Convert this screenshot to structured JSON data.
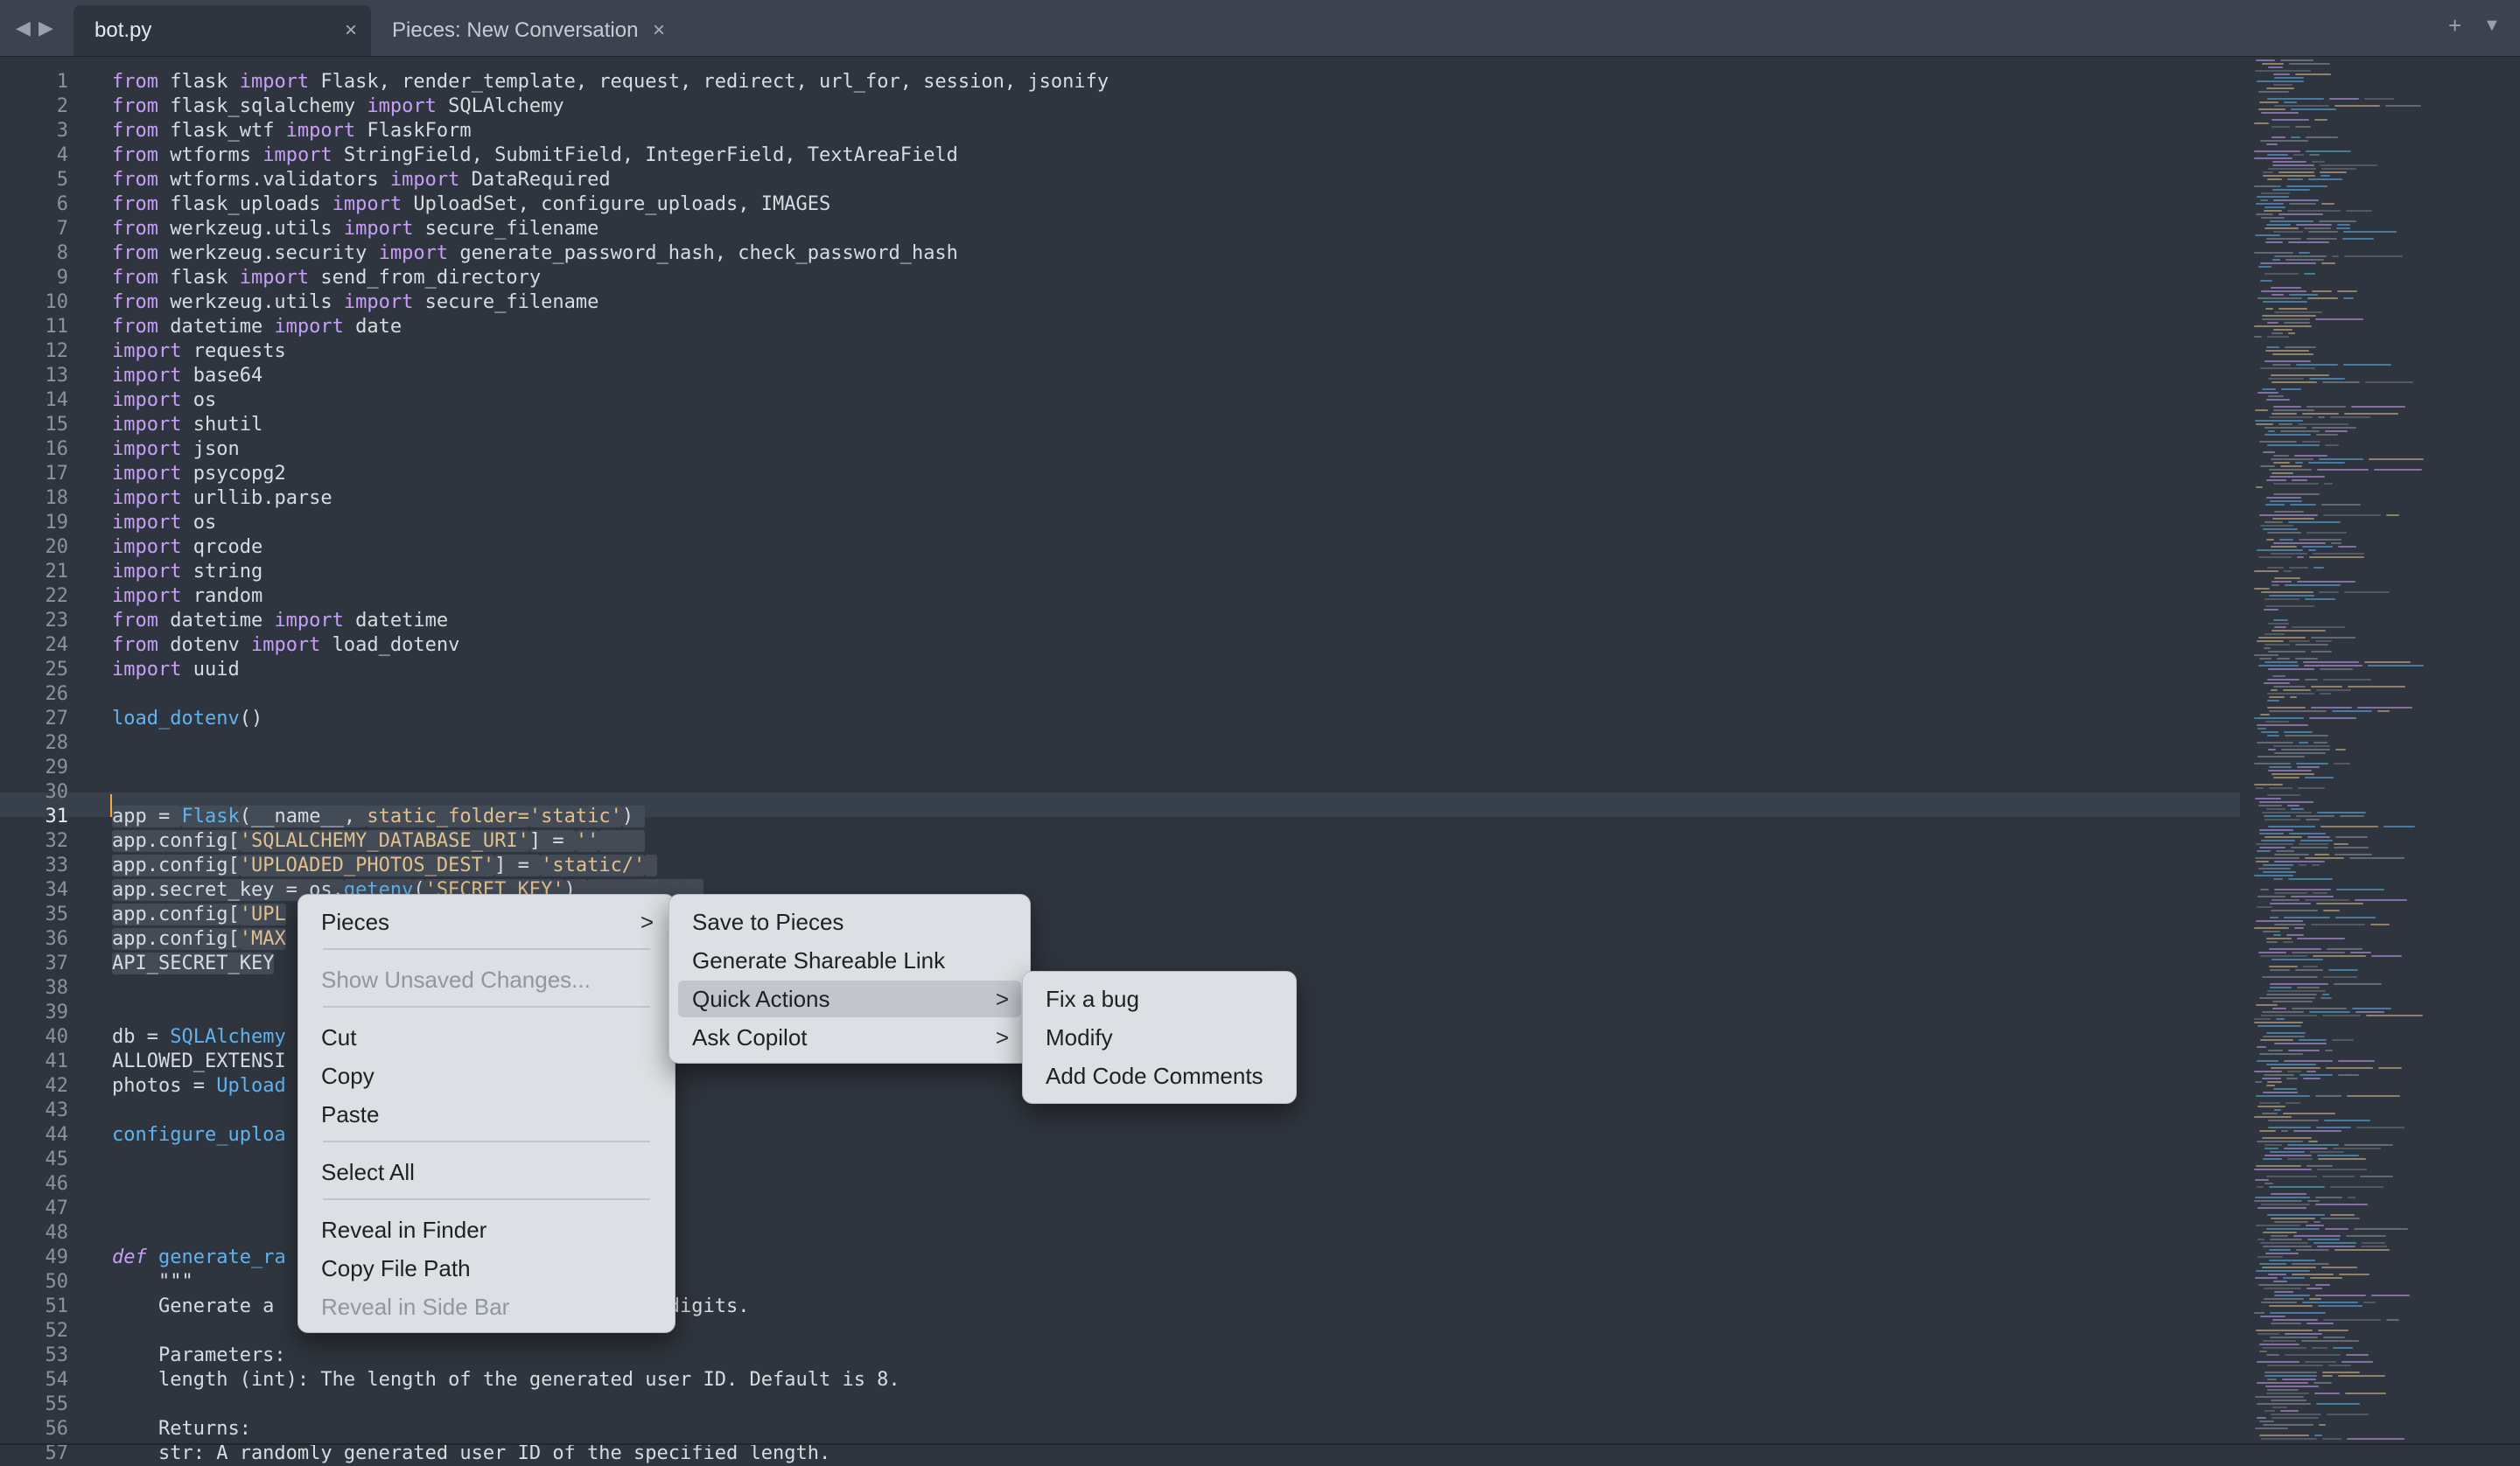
{
  "tabs": {
    "nav_back": "◀",
    "nav_forward": "▶",
    "items": [
      {
        "label": "bot.py",
        "close": "×"
      },
      {
        "label": "Pieces: New Conversation",
        "close": "×"
      }
    ],
    "new_tab": "+",
    "dropdown": "▼"
  },
  "editor": {
    "current_line": 31,
    "line_numbers": [
      "1",
      "2",
      "3",
      "4",
      "5",
      "6",
      "7",
      "8",
      "9",
      "10",
      "11",
      "12",
      "13",
      "14",
      "15",
      "16",
      "17",
      "18",
      "19",
      "20",
      "21",
      "22",
      "23",
      "24",
      "25",
      "26",
      "27",
      "28",
      "29",
      "30",
      "31",
      "32",
      "33",
      "34",
      "35",
      "36",
      "37",
      "38",
      "39",
      "40",
      "41",
      "42",
      "43",
      "44",
      "45",
      "46",
      "47",
      "48",
      "49",
      "50",
      "51",
      "52",
      "53",
      "54",
      "55",
      "56",
      "57"
    ],
    "lines": [
      [
        {
          "t": "from",
          "c": "kw"
        },
        {
          "t": " flask "
        },
        {
          "t": "import",
          "c": "kw"
        },
        {
          "t": " Flask, render_template, request, redirect, url_for, session, jsonify"
        }
      ],
      [
        {
          "t": "from",
          "c": "kw"
        },
        {
          "t": " flask_sqlalchemy "
        },
        {
          "t": "import",
          "c": "kw"
        },
        {
          "t": " SQLAlchemy"
        }
      ],
      [
        {
          "t": "from",
          "c": "kw"
        },
        {
          "t": " flask_wtf "
        },
        {
          "t": "import",
          "c": "kw"
        },
        {
          "t": " FlaskForm"
        }
      ],
      [
        {
          "t": "from",
          "c": "kw"
        },
        {
          "t": " wtforms "
        },
        {
          "t": "import",
          "c": "kw"
        },
        {
          "t": " StringField, SubmitField, IntegerField, TextAreaField"
        }
      ],
      [
        {
          "t": "from",
          "c": "kw"
        },
        {
          "t": " wtforms.validators "
        },
        {
          "t": "import",
          "c": "kw"
        },
        {
          "t": " DataRequired"
        }
      ],
      [
        {
          "t": "from",
          "c": "kw"
        },
        {
          "t": " flask_uploads "
        },
        {
          "t": "import",
          "c": "kw"
        },
        {
          "t": " UploadSet, configure_uploads, IMAGES"
        }
      ],
      [
        {
          "t": "from",
          "c": "kw"
        },
        {
          "t": " werkzeug.utils "
        },
        {
          "t": "import",
          "c": "kw"
        },
        {
          "t": " secure_filename"
        }
      ],
      [
        {
          "t": "from",
          "c": "kw"
        },
        {
          "t": " werkzeug.security "
        },
        {
          "t": "import",
          "c": "kw"
        },
        {
          "t": " generate_password_hash, check_password_hash"
        }
      ],
      [
        {
          "t": "from",
          "c": "kw"
        },
        {
          "t": " flask "
        },
        {
          "t": "import",
          "c": "kw"
        },
        {
          "t": " send_from_directory"
        }
      ],
      [
        {
          "t": "from",
          "c": "kw"
        },
        {
          "t": " werkzeug.utils "
        },
        {
          "t": "import",
          "c": "kw"
        },
        {
          "t": " secure_filename"
        }
      ],
      [
        {
          "t": "from",
          "c": "kw"
        },
        {
          "t": " datetime "
        },
        {
          "t": "import",
          "c": "kw"
        },
        {
          "t": " date"
        }
      ],
      [
        {
          "t": "import",
          "c": "kw"
        },
        {
          "t": " requests"
        }
      ],
      [
        {
          "t": "import",
          "c": "kw"
        },
        {
          "t": " base64"
        }
      ],
      [
        {
          "t": "import",
          "c": "kw"
        },
        {
          "t": " os"
        }
      ],
      [
        {
          "t": "import",
          "c": "kw"
        },
        {
          "t": " shutil"
        }
      ],
      [
        {
          "t": "import",
          "c": "kw"
        },
        {
          "t": " json"
        }
      ],
      [
        {
          "t": "import",
          "c": "kw"
        },
        {
          "t": " psycopg2"
        }
      ],
      [
        {
          "t": "import",
          "c": "kw"
        },
        {
          "t": " urllib.parse"
        }
      ],
      [
        {
          "t": "import",
          "c": "kw"
        },
        {
          "t": " os"
        }
      ],
      [
        {
          "t": "import",
          "c": "kw"
        },
        {
          "t": " qrcode"
        }
      ],
      [
        {
          "t": "import",
          "c": "kw"
        },
        {
          "t": " string"
        }
      ],
      [
        {
          "t": "import",
          "c": "kw"
        },
        {
          "t": " random"
        }
      ],
      [
        {
          "t": "from",
          "c": "kw"
        },
        {
          "t": " datetime "
        },
        {
          "t": "import",
          "c": "kw"
        },
        {
          "t": " datetime"
        }
      ],
      [
        {
          "t": "from",
          "c": "kw"
        },
        {
          "t": " dotenv "
        },
        {
          "t": "import",
          "c": "kw"
        },
        {
          "t": " load_dotenv"
        }
      ],
      [
        {
          "t": "import",
          "c": "kw"
        },
        {
          "t": " uuid"
        }
      ],
      [],
      [
        {
          "t": "load_dotenv",
          "c": "fn"
        },
        {
          "t": "()"
        }
      ],
      [],
      [],
      [],
      [
        {
          "t": "app = ",
          "s": 1
        },
        {
          "t": "Flask",
          "c": "fn",
          "s": 1
        },
        {
          "t": "(__name__, ",
          "s": 1
        },
        {
          "t": "static_folder=",
          "c": "st",
          "s": 1
        },
        {
          "t": "'static'",
          "c": "st",
          "s": 1
        },
        {
          "t": ") ",
          "s": 1
        }
      ],
      [
        {
          "t": "app.config[",
          "s": 1
        },
        {
          "t": "'SQLALCHEMY_DATABASE_URI'",
          "c": "st",
          "s": 1
        },
        {
          "t": "] = ",
          "s": 1
        },
        {
          "t": "''",
          "c": "st",
          "s": 1
        },
        {
          "t": "    ",
          "s": 1
        }
      ],
      [
        {
          "t": "app.config[",
          "s": 1
        },
        {
          "t": "'UPLOADED_PHOTOS_DEST'",
          "c": "st",
          "s": 1
        },
        {
          "t": "] = ",
          "s": 1
        },
        {
          "t": "'static/'",
          "c": "st",
          "s": 1
        },
        {
          "t": " ",
          "s": 1
        }
      ],
      [
        {
          "t": "app.secret_key = os.",
          "s": 1
        },
        {
          "t": "getenv",
          "c": "fn",
          "s": 1
        },
        {
          "t": "(",
          "s": 1
        },
        {
          "t": "'SECRET_KEY'",
          "c": "st",
          "s": 1
        },
        {
          "t": ") ",
          "s": 1
        },
        {
          "t": "          ",
          "s": 1
        }
      ],
      [
        {
          "t": "app.config[",
          "s": 1
        },
        {
          "t": "'UPL",
          "c": "st",
          "s": 1
        }
      ],
      [
        {
          "t": "app.config[",
          "s": 1
        },
        {
          "t": "'MAX",
          "c": "st",
          "s": 1
        }
      ],
      [
        {
          "t": "API_SECRET_KEY",
          "s": 1
        }
      ],
      [],
      [],
      [
        {
          "t": "db = "
        },
        {
          "t": "SQLAlchemy",
          "c": "fn"
        }
      ],
      [
        {
          "t": "ALLOWED_EXTENSI"
        }
      ],
      [
        {
          "t": "photos = "
        },
        {
          "t": "Upload",
          "c": "fn"
        }
      ],
      [],
      [
        {
          "t": "configure_uploa",
          "c": "fn"
        }
      ],
      [],
      [],
      [],
      [],
      [
        {
          "t": "def",
          "c": "it"
        },
        {
          "t": " "
        },
        {
          "t": "generate_ra",
          "c": "fn"
        }
      ],
      [
        {
          "t": "    \"\"\""
        }
      ],
      [
        {
          "t": "    Generate a                        tters and digits."
        }
      ],
      [],
      [
        {
          "t": "    Parameters:"
        }
      ],
      [
        {
          "t": "    length (int): The length of the generated user ID. Default is 8."
        }
      ],
      [],
      [
        {
          "t": "    Returns:"
        }
      ],
      [
        {
          "t": "    str: A randomly generated user ID of the specified length."
        }
      ]
    ]
  },
  "context_menu": {
    "items": [
      {
        "label": "Pieces",
        "submenu": true
      },
      {
        "separator": true
      },
      {
        "label": "Show Unsaved Changes...",
        "disabled": true
      },
      {
        "separator": true
      },
      {
        "label": "Cut"
      },
      {
        "label": "Copy"
      },
      {
        "label": "Paste"
      },
      {
        "separator": true
      },
      {
        "label": "Select All"
      },
      {
        "separator": true
      },
      {
        "label": "Reveal in Finder"
      },
      {
        "label": "Copy File Path"
      },
      {
        "label": "Reveal in Side Bar",
        "disabled": true
      }
    ],
    "arrow": ">"
  },
  "pieces_menu": {
    "items": [
      {
        "label": "Save to Pieces"
      },
      {
        "label": "Generate Shareable Link"
      },
      {
        "label": "Quick Actions",
        "submenu": true,
        "highlighted": true
      },
      {
        "label": "Ask Copilot",
        "submenu": true
      }
    ]
  },
  "quick_actions_menu": {
    "items": [
      {
        "label": "Fix a bug"
      },
      {
        "label": "Modify"
      },
      {
        "label": "Add Code Comments"
      }
    ]
  },
  "colors": {
    "background": "#2f353e",
    "keyword": "#c89ef7",
    "function": "#5fb3f0",
    "string": "#e2c08d",
    "menu_bg": "#dcdfe3",
    "caret": "#f5a742"
  }
}
